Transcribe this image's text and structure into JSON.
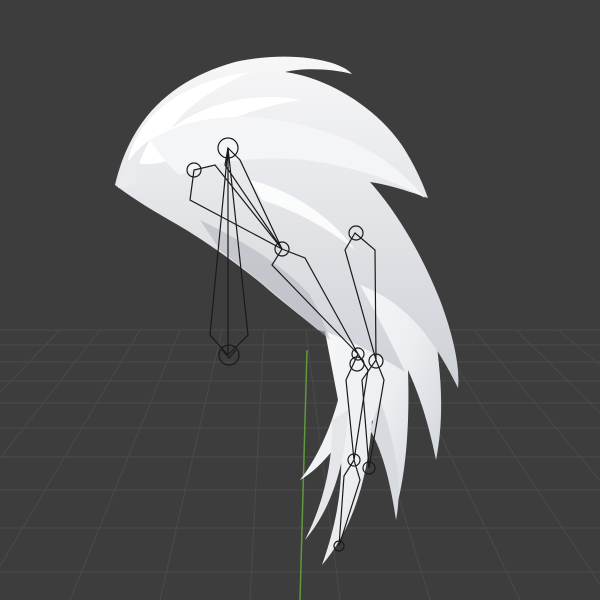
{
  "viewport": {
    "background": "#3d3d3d",
    "grid_color": "#4a4a4a",
    "axis_color": "#5f9a3a"
  },
  "model": {
    "name": "hair-mesh",
    "color": "#f0f0f0",
    "shade": "#c9ccd2",
    "highlight": "#ffffff"
  },
  "armature": {
    "name": "bone-chain",
    "stroke": "#1a1a1a"
  }
}
